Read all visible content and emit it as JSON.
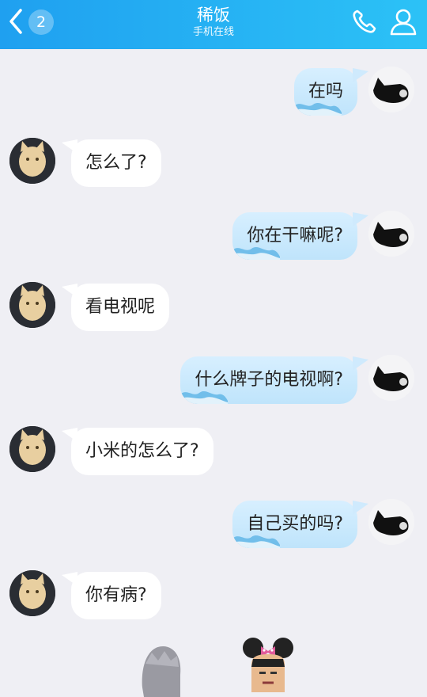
{
  "header": {
    "unread_count": "2",
    "contact_name": "稀饭",
    "status": "手机在线"
  },
  "messages": [
    {
      "side": "me",
      "text": "在吗"
    },
    {
      "side": "peer",
      "text": "怎么了?"
    },
    {
      "side": "me",
      "text": "你在干嘛呢?"
    },
    {
      "side": "peer",
      "text": "看电视呢"
    },
    {
      "side": "me",
      "text": "什么牌子的电视啊?"
    },
    {
      "side": "peer",
      "text": "小米的怎么了?"
    },
    {
      "side": "me",
      "text": "自己买的吗?"
    },
    {
      "side": "peer",
      "text": "你有病?"
    }
  ],
  "colors": {
    "header_start": "#1fa0f0",
    "header_end": "#2cc2f6",
    "background": "#efeff4",
    "my_bubble": "#c9e9ff",
    "peer_bubble": "#ffffff"
  },
  "icons": {
    "back": "chevron-left-icon",
    "call": "phone-icon",
    "profile": "person-icon"
  }
}
